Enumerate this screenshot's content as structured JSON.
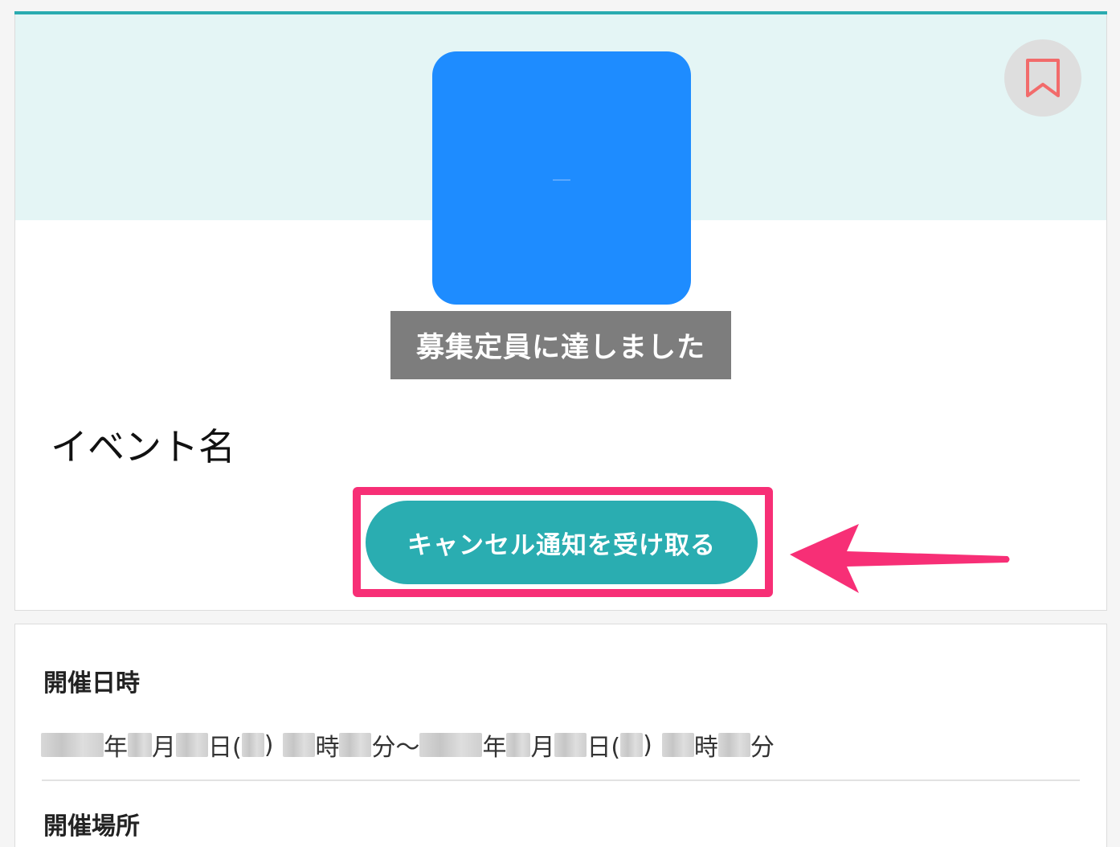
{
  "event": {
    "full_badge": "募集定員に達しました",
    "title": "イベント名",
    "cancel_notify_button": "キャンセル通知を受け取る"
  },
  "details": {
    "datetime_heading": "開催日時",
    "datetime_parts": [
      "年",
      "月",
      "日(",
      ")",
      "時",
      "分〜",
      "年",
      "月",
      "日(",
      ")",
      "時",
      "分"
    ],
    "venue_heading": "開催場所"
  },
  "icons": {
    "bookmark": "bookmark-icon",
    "arrow": "arrow-left-icon"
  },
  "colors": {
    "accent": "#2aabb0",
    "event_image": "#1e8cff",
    "highlight": "#f72f76",
    "bookmark": "#f26b6b"
  }
}
